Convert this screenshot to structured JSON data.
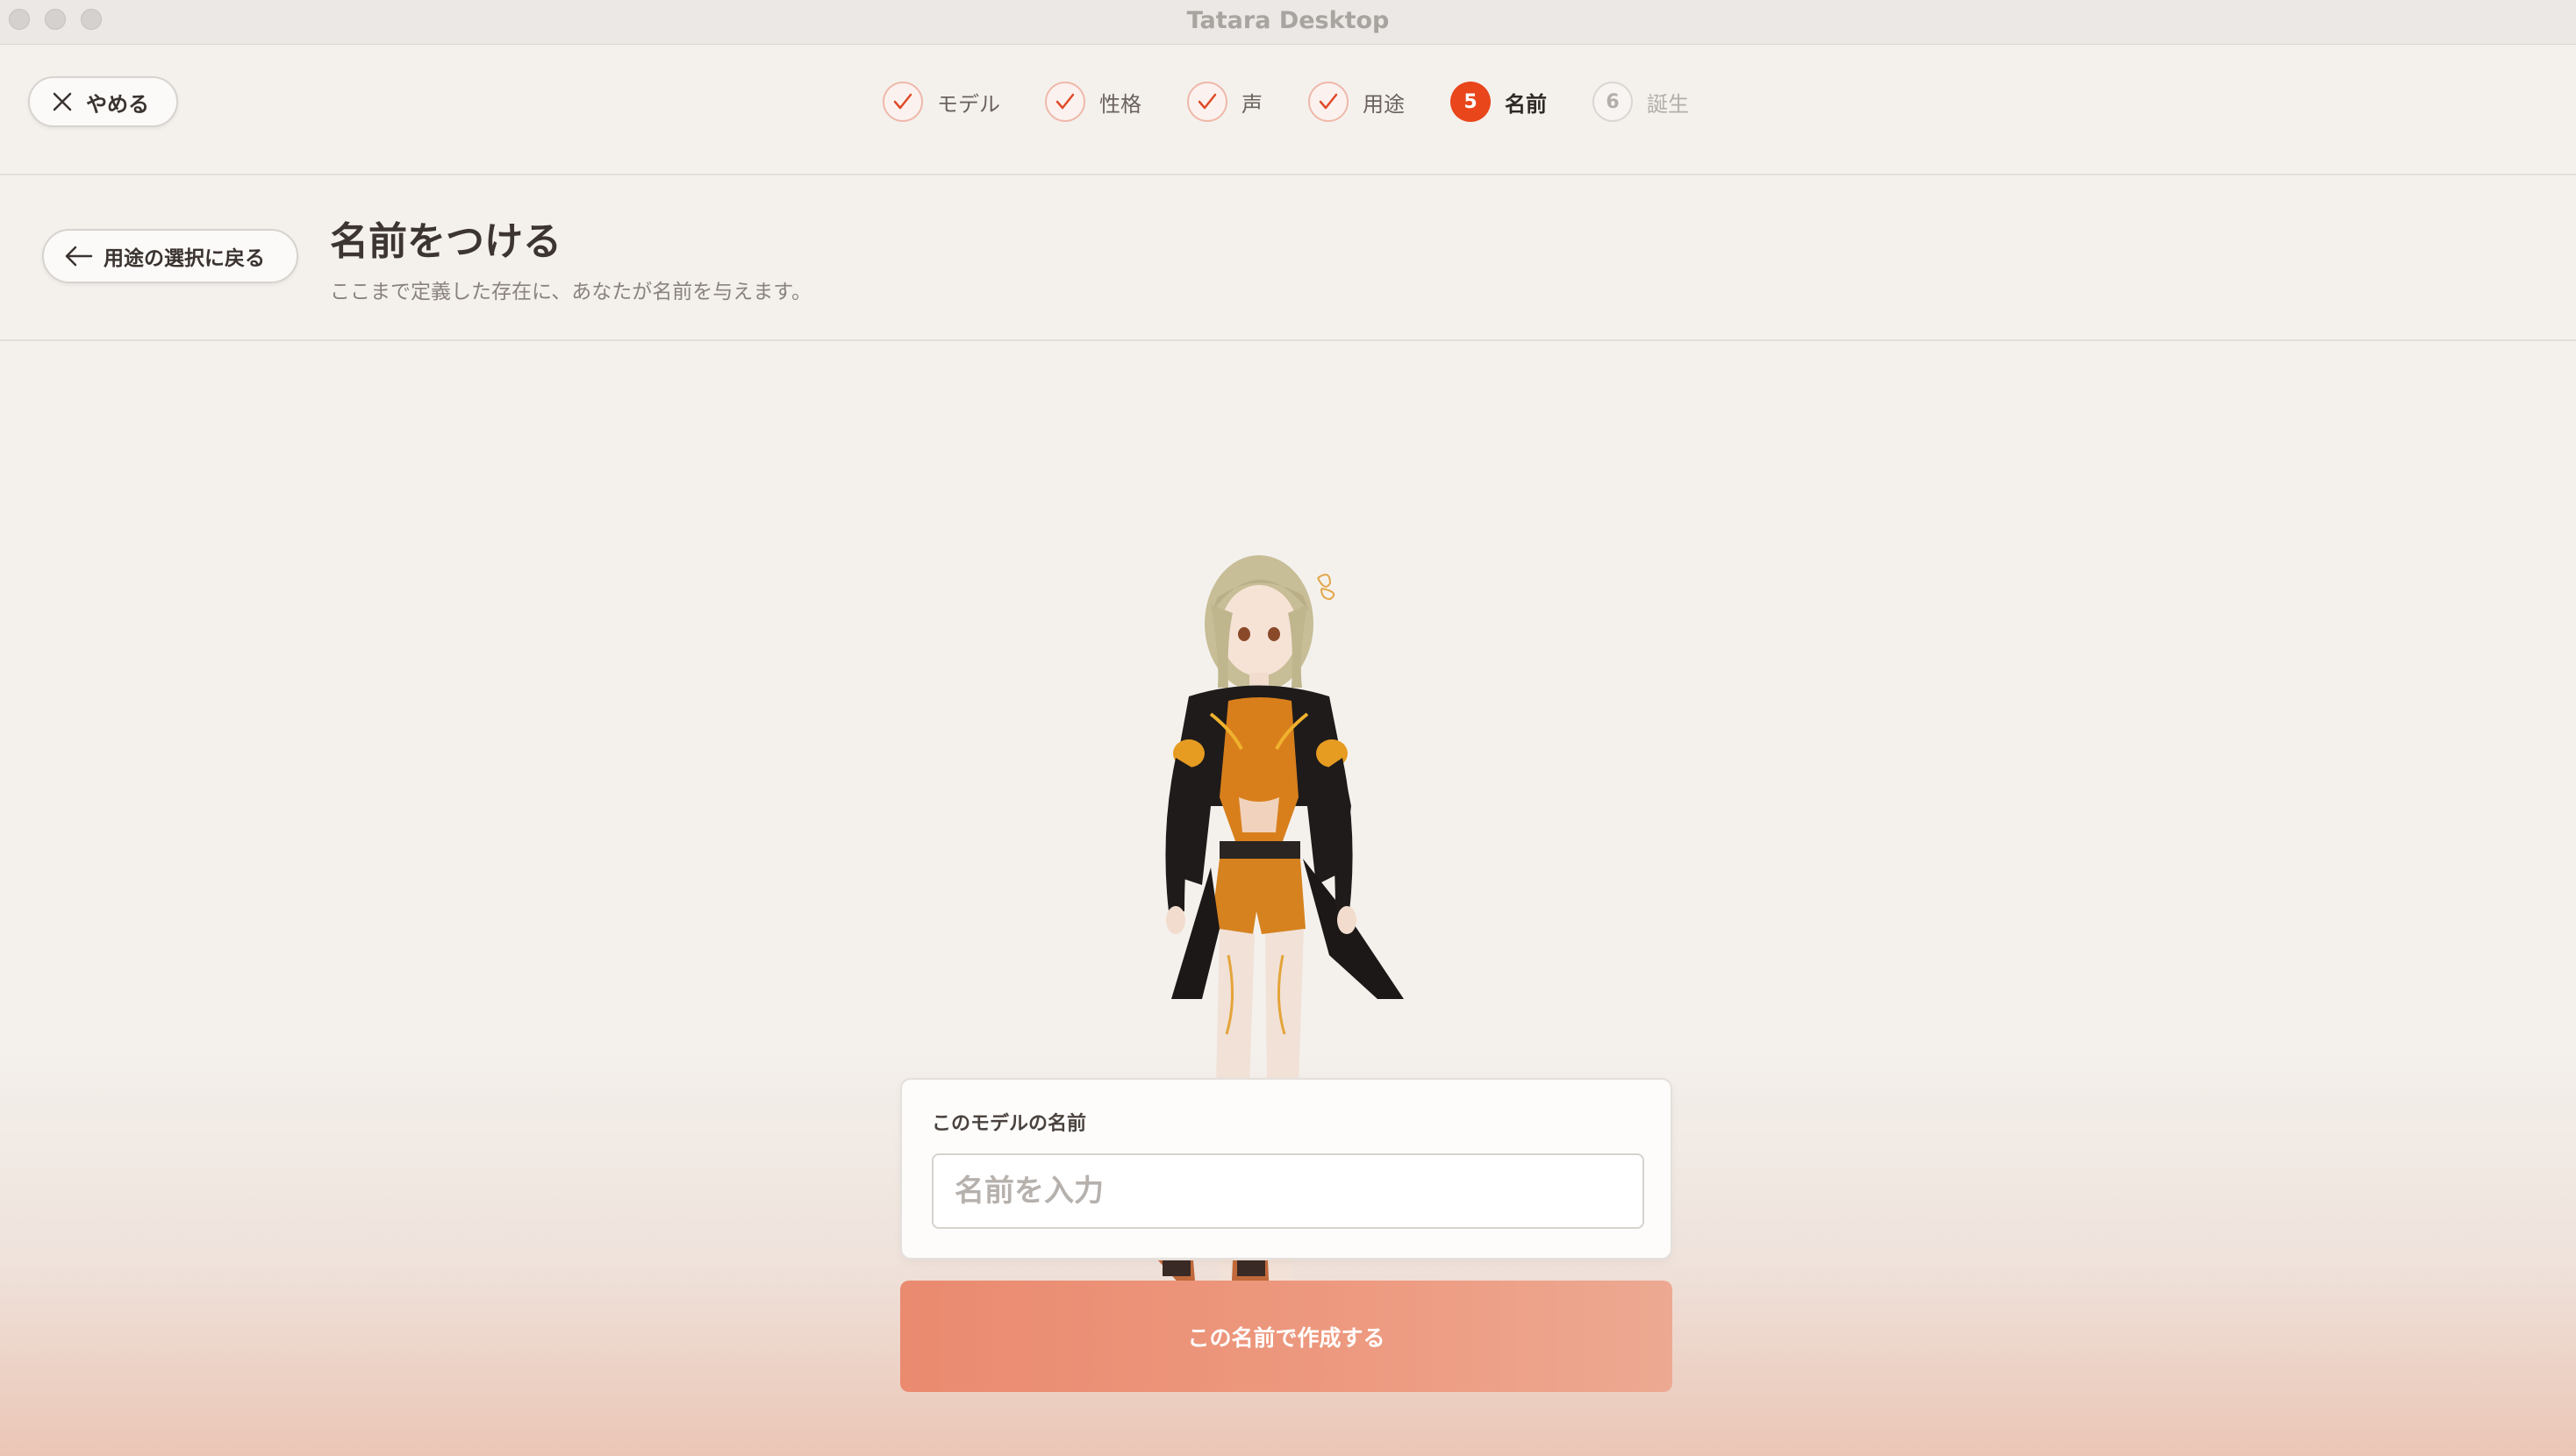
{
  "window": {
    "title": "Tatara Desktop"
  },
  "header": {
    "quit_label": "やめる",
    "steps": [
      {
        "label": "モデル",
        "state": "done"
      },
      {
        "label": "性格",
        "state": "done"
      },
      {
        "label": "声",
        "state": "done"
      },
      {
        "label": "用途",
        "state": "done"
      },
      {
        "number": "5",
        "label": "名前",
        "state": "active"
      },
      {
        "number": "6",
        "label": "誕生",
        "state": "todo"
      }
    ]
  },
  "page": {
    "back_label": "用途の選択に戻る",
    "title": "名前をつける",
    "subtitle": "ここまで定義した存在に、あなたが名前を与えます。"
  },
  "form": {
    "label": "このモデルの名前",
    "input_placeholder": "名前を入力",
    "input_value": "",
    "submit_label": "この名前で作成する"
  },
  "colors": {
    "accent": "#e9461c",
    "button": "#ea8a6f",
    "background": "#f4f1ed"
  }
}
